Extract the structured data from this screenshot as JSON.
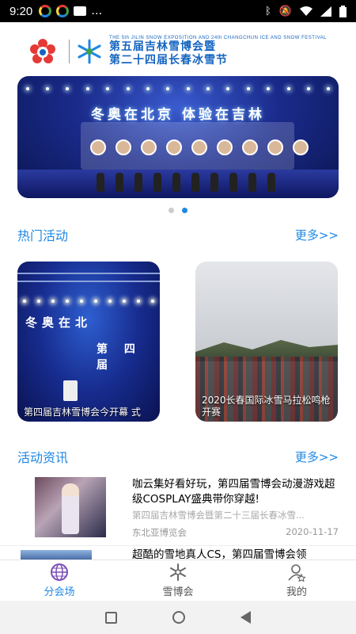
{
  "status_bar": {
    "time": "9:20",
    "more": "…",
    "battery_icon": "battery-icon",
    "wifi_icon": "wifi-icon",
    "signal_icon": "signal-icon"
  },
  "header": {
    "subtitle_en": "THE 5th JILIN SNOW EXPOSITION AND 24th CHANGCHUN ICE AND SNOW FESTIVAL",
    "title_line1": "第五届吉林雪博会暨",
    "title_line2": "第二十四届长春冰雪节"
  },
  "banner": {
    "slogan": "冬奥在北京 体验在吉林",
    "active_index": 1,
    "count": 2
  },
  "hot_section": {
    "title": "热门活动",
    "more": "更多>>"
  },
  "hot_cards": [
    {
      "caption": "第四届吉林雪博会今开幕 式",
      "image_text_main": "冬奥在北",
      "image_text_sub": "第 四 届"
    },
    {
      "caption": "2020长春国际冰雪马拉松鸣枪开赛"
    }
  ],
  "news_section": {
    "title": "活动资讯",
    "more": "更多>>"
  },
  "news": [
    {
      "headline": "咖云集好看好玩，第四届雪博会动漫游戏超级COSPLAY盛典带你穿越!",
      "summary": "第四届吉林雪博会暨第二十三届长春冰雪...",
      "source": "东北亚博览会",
      "date": "2020-11-17"
    },
    {
      "headline": "超酷的雪地真人CS，第四届雪博会领"
    }
  ],
  "tabs": [
    {
      "label": "分会场",
      "icon": "globe-icon",
      "active": true
    },
    {
      "label": "雪博会",
      "icon": "snowflake-icon",
      "active": false
    },
    {
      "label": "我的",
      "icon": "user-icon",
      "active": false
    }
  ],
  "colors": {
    "accent": "#1e88e5",
    "brand": "#1565c0"
  }
}
